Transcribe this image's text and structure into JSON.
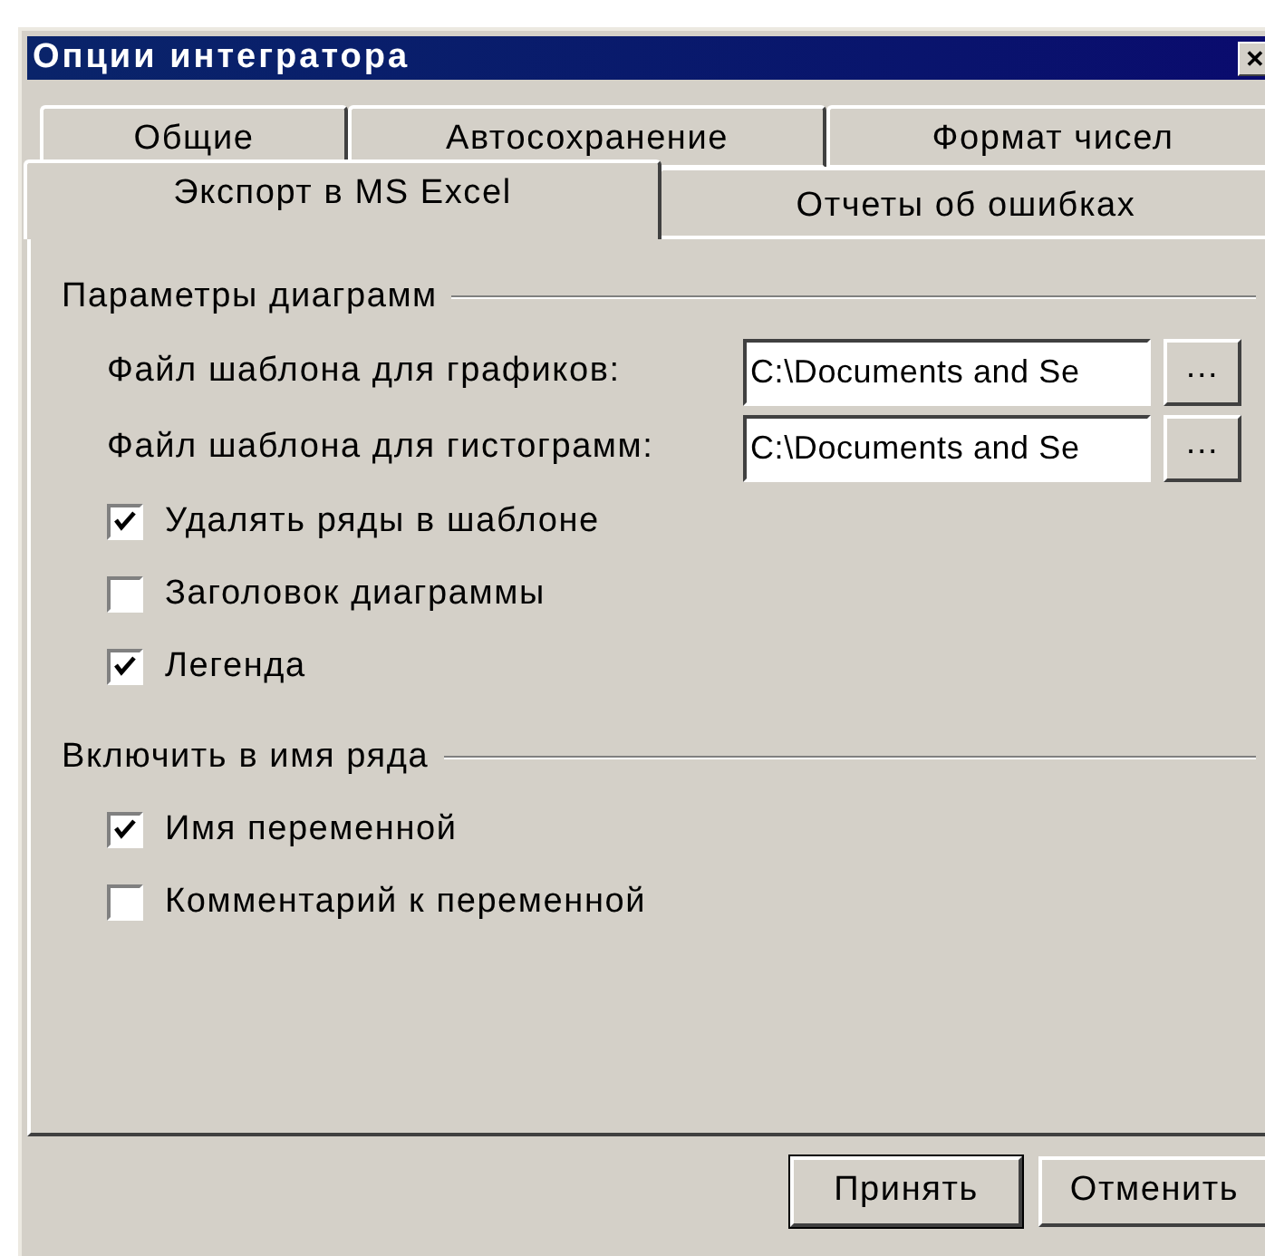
{
  "window": {
    "title": "Опции интегратора",
    "close": "✕"
  },
  "tab_rows": [
    [
      {
        "label": "Общие",
        "selected": false
      },
      {
        "label": "Автосохранение",
        "selected": false
      },
      {
        "label": "Формат чисел",
        "selected": false
      }
    ],
    [
      {
        "label": "Экспорт в MS Excel",
        "selected": true
      },
      {
        "label": "Отчеты об ошибках",
        "selected": false
      }
    ]
  ],
  "groups": [
    {
      "title": "Параметры диаграмм",
      "items": [
        {
          "kind": "file",
          "label": "Файл шаблона для графиков:",
          "value": "C:\\Documents and Se",
          "browse": "..."
        },
        {
          "kind": "file",
          "label": "Файл шаблона для гистограмм:",
          "value": "C:\\Documents and Se",
          "browse": "..."
        },
        {
          "kind": "checkbox",
          "label": "Удалять ряды в шаблоне",
          "checked": true
        },
        {
          "kind": "checkbox",
          "label": "Заголовок диаграммы",
          "checked": false
        },
        {
          "kind": "checkbox",
          "label": "Легенда",
          "checked": true
        }
      ]
    },
    {
      "title": "Включить в имя ряда",
      "items": [
        {
          "kind": "checkbox",
          "label": "Имя переменной",
          "checked": true
        },
        {
          "kind": "checkbox",
          "label": "Комментарий к переменной",
          "checked": false
        }
      ]
    }
  ],
  "buttons": [
    {
      "label": "Принять",
      "default": true
    },
    {
      "label": "Отменить",
      "default": false
    }
  ]
}
